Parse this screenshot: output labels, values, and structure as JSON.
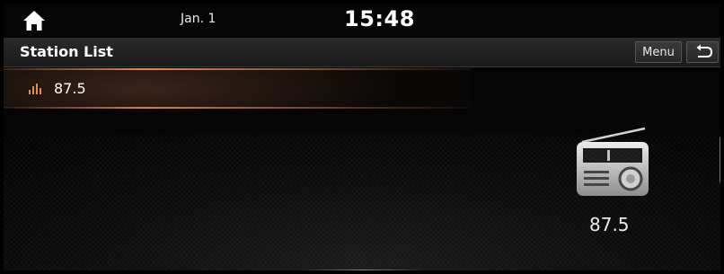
{
  "status_bar": {
    "date": "Jan. 1",
    "time": "15:48"
  },
  "header": {
    "title": "Station List",
    "menu_label": "Menu"
  },
  "station_list": [
    {
      "frequency": "87.5"
    }
  ],
  "now_playing": {
    "frequency": "87.5"
  },
  "icons": {
    "home": "home-icon",
    "back": "back-arrow-icon",
    "playing": "equalizer-icon",
    "radio": "radio-icon",
    "handle": "chevron-left-icon"
  },
  "colors": {
    "accent": "#e08a5a",
    "background": "#0a0a0a"
  }
}
